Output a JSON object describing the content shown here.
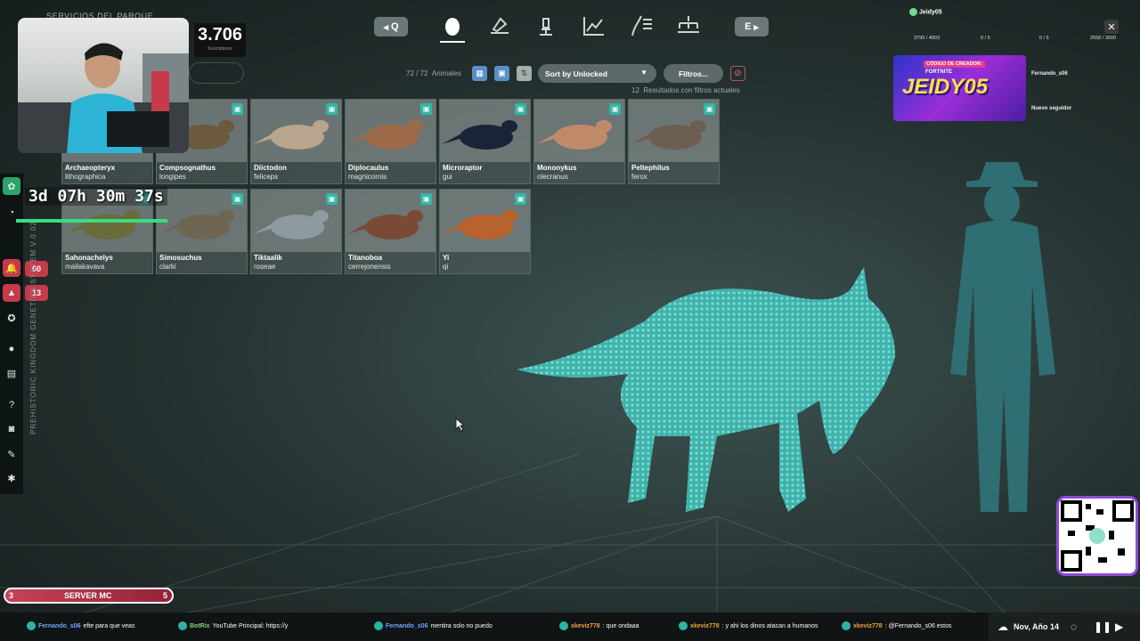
{
  "stream": {
    "park_services_label": "SERVICIOS DEL PARQUE",
    "subscribers": "3.706",
    "subscribers_label": "Suscriptores",
    "timer": "3d 07h 30m 37s",
    "user": "Jeidy05",
    "stats": [
      "3799 / 4003",
      "0 / 5",
      "0 / 5",
      "2558 / 3000"
    ],
    "promo_code_label": "CÓDIGO DE CREADOR:",
    "promo_brand": "JEIDY05",
    "promo_sub": "FORTNITE",
    "feed": [
      {
        "name": "Fernando_s06",
        "icon": "follower-icon"
      },
      {
        "name": "Nuevo seguidor",
        "icon": "follow-icon"
      }
    ],
    "server": {
      "left": "3",
      "label": "SERVER MC",
      "right": "5"
    }
  },
  "nav": {
    "prev_key": "Q",
    "next_key": "E",
    "tabs": [
      {
        "icon": "egg-icon",
        "active": true
      },
      {
        "icon": "microscope-tray-icon",
        "active": false
      },
      {
        "icon": "microscope-icon",
        "active": false
      },
      {
        "icon": "chart-icon",
        "active": false
      },
      {
        "icon": "dino-list-icon",
        "active": false
      },
      {
        "icon": "hierarchy-icon",
        "active": false
      }
    ]
  },
  "toolbar": {
    "count": "72 / 72",
    "count_label": "Animales",
    "sort": "Sort by Unlocked",
    "filters": "Filtros...",
    "results": "12",
    "results_label": "Resultados con filtros actuales"
  },
  "animals": [
    {
      "name": "Archaeopteryx",
      "species": "lithographica",
      "color": "#7a5a3c"
    },
    {
      "name": "Compsognathus",
      "species": "longipes",
      "color": "#6b5940"
    },
    {
      "name": "Diictodon",
      "species": "feliceps",
      "color": "#b7a58d"
    },
    {
      "name": "Diplocaulus",
      "species": "magnicornis",
      "color": "#9c6a48"
    },
    {
      "name": "Microraptor",
      "species": "gui",
      "color": "#1a2438"
    },
    {
      "name": "Mononykus",
      "species": "olecranus",
      "color": "#c08a6a"
    },
    {
      "name": "Peltephilus",
      "species": "ferox",
      "color": "#6c5f52"
    },
    {
      "name": "Sahonachelys",
      "species": "mailakavava",
      "color": "#6a6a3a"
    },
    {
      "name": "Simosuchus",
      "species": "clarki",
      "color": "#6e6552"
    },
    {
      "name": "Tiktaalik",
      "species": "roseae",
      "color": "#8f9aa0"
    },
    {
      "name": "Titanoboa",
      "species": "cerrejonensis",
      "color": "#7a4a36"
    },
    {
      "name": "Yi",
      "species": "qi",
      "color": "#b8622e"
    }
  ],
  "left_rail": {
    "badges": [
      "60",
      "13"
    ],
    "version_label": "PREHISTORIC KINGDOM GENETICS SYSTEM V.0.02"
  },
  "chat": [
    {
      "user": "Fernando_s06",
      "text": "efte para que veas",
      "cls": ""
    },
    {
      "user": "BotRix",
      "text": "YouTube Principal: https://y",
      "cls": "gr"
    },
    {
      "user": "Fernando_s06",
      "text": "mentira solo no puedo",
      "cls": ""
    },
    {
      "user": "xkeviz778",
      "text": ": que ondaaa",
      "cls": "or"
    },
    {
      "user": "xkeviz778",
      "text": ": y ahi los dinos atacan a humanos",
      "cls": "or"
    },
    {
      "user": "xkeviz778",
      "text": ": @Fernando_s06 estos",
      "cls": "or"
    }
  ],
  "date": "Nov, Año 14"
}
